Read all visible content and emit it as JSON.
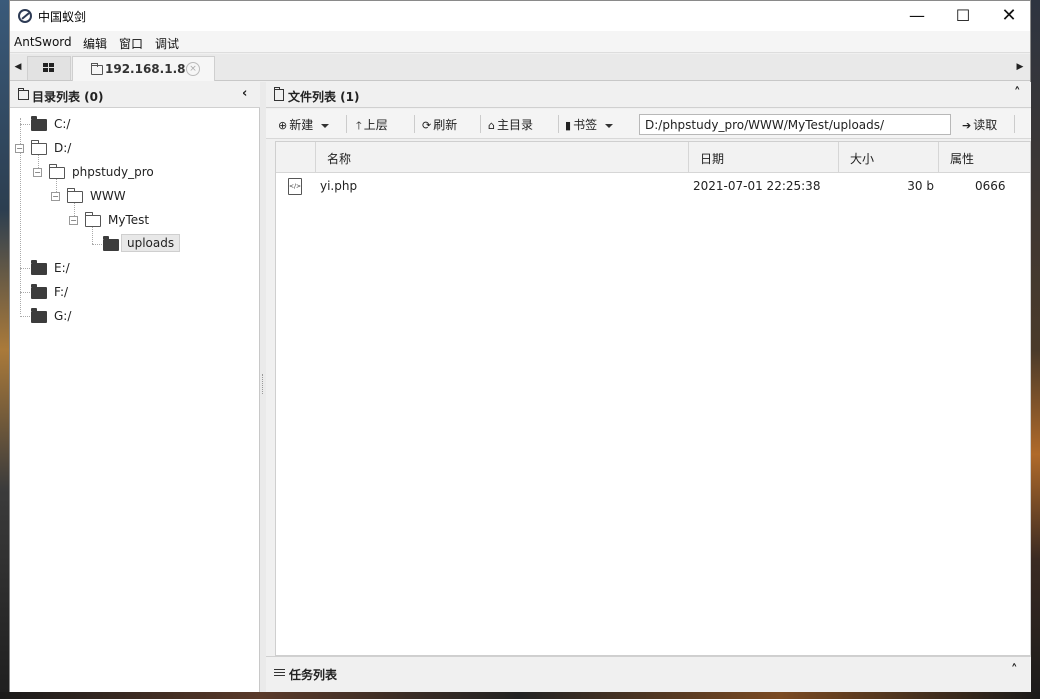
{
  "window": {
    "title": "中国蚁剑"
  },
  "controls": {
    "minimize": "—",
    "maximize": "☐",
    "close": "✕"
  },
  "menu": [
    "AntSword",
    "编辑",
    "窗口",
    "调试"
  ],
  "tabs": {
    "active_label": "192.168.1.8",
    "close_symbol": "×"
  },
  "left_panel": {
    "title": "目录列表 (0)",
    "collapse_symbol": "‹",
    "tree": [
      {
        "label": "C:/"
      },
      {
        "label": "D:/"
      },
      {
        "label": "phpstudy_pro"
      },
      {
        "label": "WWW"
      },
      {
        "label": "MyTest"
      },
      {
        "label": "uploads"
      },
      {
        "label": "E:/"
      },
      {
        "label": "F:/"
      },
      {
        "label": "G:/"
      }
    ]
  },
  "right_panel": {
    "title": "文件列表 (1)",
    "collapse_symbol": "˄",
    "toolbar": {
      "new": "新建",
      "up": "上层",
      "refresh": "刷新",
      "home": "主目录",
      "bookmark": "书签",
      "path": "D:/phpstudy_pro/WWW/MyTest/uploads/",
      "read": "读取"
    },
    "columns": [
      "名称",
      "日期",
      "大小",
      "属性"
    ],
    "files": [
      {
        "name": "yi.php",
        "date": "2021-07-01 22:25:38",
        "size": "30 b",
        "perm": "0666"
      }
    ]
  },
  "task_panel": {
    "title": "任务列表",
    "collapse_symbol": "˄"
  },
  "icons": {
    "app": "antsword-logo-icon",
    "new": "plus-circle-icon",
    "up": "arrow-up-icon",
    "refresh": "refresh-icon",
    "home": "home-icon",
    "bookmark": "bookmark-icon",
    "read": "arrow-right-icon",
    "file": "php-file-icon"
  }
}
